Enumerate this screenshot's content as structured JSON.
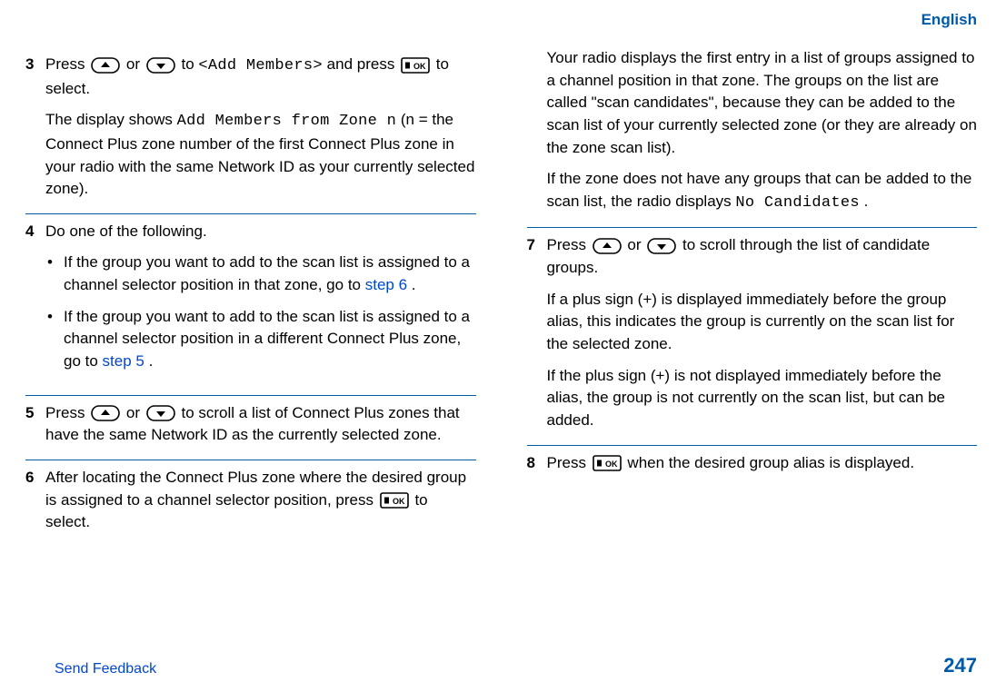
{
  "header": {
    "language": "English"
  },
  "left": {
    "step3": {
      "num": "3",
      "t1a": "Press ",
      "t1b": " or ",
      "t1c": " to ",
      "mono1": "<Add Members>",
      "t1d": " and press ",
      "t1e": " to select.",
      "t2a": "The display shows ",
      "mono2": "Add Members from Zone n",
      "t2b": " (n = the Connect Plus zone number of the first Connect Plus zone in your radio with the same Network ID as your currently selected zone)."
    },
    "step4": {
      "num": "4",
      "t1": "Do one of the following.",
      "b1a": "If the group you want to add to the scan list is assigned to a channel selector position in that zone, go to ",
      "b1link": "step 6",
      "b1b": ".",
      "b2a": "If the group you want to add to the scan list is assigned to a channel selector position in a different Connect Plus zone, go to ",
      "b2link": "step 5",
      "b2b": "."
    },
    "step5": {
      "num": "5",
      "t1a": "Press ",
      "t1b": " or ",
      "t1c": " to scroll a list of Connect Plus zones that have the same Network ID as the currently selected zone."
    },
    "step6": {
      "num": "6",
      "t1a": "After locating the Connect Plus zone where the desired group is assigned to a channel selector position, press ",
      "t1b": " to select."
    }
  },
  "right": {
    "cont": {
      "t1": "Your radio displays the first entry in a list of groups assigned to a channel position in that zone. The groups on the list are called \"scan candidates\", because they can be added to the scan list of your currently selected zone (or they are already on the zone scan list).",
      "t2a": "If the zone does not have any groups that can be added to the scan list, the radio displays ",
      "mono1": "No Candidates",
      "t2b": "."
    },
    "step7": {
      "num": "7",
      "t1a": "Press ",
      "t1b": " or ",
      "t1c": " to scroll through the list of candidate groups.",
      "t2": "If a plus sign (+) is displayed immediately before the group alias, this indicates the group is currently on the scan list for the selected zone.",
      "t3": "If the plus sign (+) is not displayed immediately before the alias, the group is not currently on the scan list, but can be added."
    },
    "step8": {
      "num": "8",
      "t1a": "Press ",
      "t1b": " when the desired group alias is displayed."
    }
  },
  "footer": {
    "feedback": "Send Feedback",
    "page": "247"
  }
}
